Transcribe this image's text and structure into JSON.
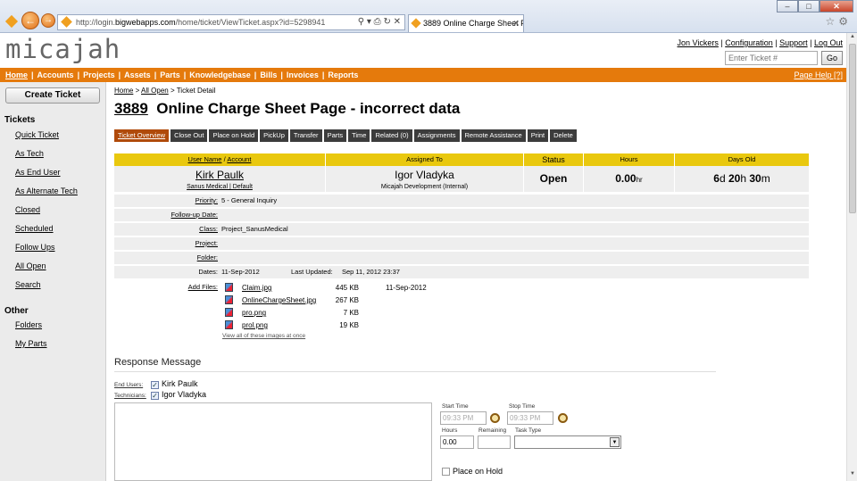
{
  "browser": {
    "url_prefix": "http://login.",
    "url_domain": "bigwebapps.com",
    "url_rest": "/home/ticket/ViewTicket.aspx?id=5298941",
    "tab_title": "3889 Online Charge Sheet P..."
  },
  "header": {
    "logo": "micajah",
    "user_links": [
      "Jon Vickers",
      "Configuration",
      "Support",
      "Log Out"
    ],
    "ticket_search_placeholder": "Enter Ticket #",
    "go_label": "Go"
  },
  "topnav": {
    "items": [
      "Home",
      "Accounts",
      "Projects",
      "Assets",
      "Parts",
      "Knowledgebase",
      "Bills",
      "Invoices",
      "Reports"
    ],
    "help": "Page Help [?]"
  },
  "sidebar": {
    "create_ticket": "Create Ticket",
    "tickets_heading": "Tickets",
    "ticket_links": [
      "Quick Ticket",
      "As Tech",
      "As End User",
      "As Alternate Tech",
      "Closed",
      "Scheduled",
      "Follow Ups",
      "All Open",
      "Search"
    ],
    "other_heading": "Other",
    "other_links": [
      "Folders",
      "My Parts"
    ]
  },
  "breadcrumb": {
    "home": "Home",
    "all_open": "All Open",
    "current": "Ticket Detail"
  },
  "ticket": {
    "number": "3889",
    "title": "Online Charge Sheet Page - incorrect data"
  },
  "tabs": [
    "Ticket Overview",
    "Close Out",
    "Place on Hold",
    "PickUp",
    "Transfer",
    "Parts",
    "Time",
    "Related (0)",
    "Assignments",
    "Remote Assistance",
    "Print",
    "Delete"
  ],
  "summary": {
    "headers": {
      "user": "User Name",
      "account": "Account",
      "assigned": "Assigned To",
      "status": "Status",
      "hours": "Hours",
      "days": "Days Old"
    },
    "user_name": "Kirk Paulk",
    "user_sub": "Sanus Medical | Default",
    "assigned_name": "Igor Vladyka",
    "assigned_sub": "Micajah Development (Internal)",
    "status": "Open",
    "hours_value": "0.00",
    "hours_unit": "hr",
    "days": "6",
    "days_unit": "d",
    "hrs": "20",
    "hrs_unit": "h",
    "mins": "30",
    "mins_unit": "m"
  },
  "details": {
    "priority_label": "Priority:",
    "priority": "5 - General Inquiry",
    "followup_label": "Follow-up Date:",
    "class_label": "Class:",
    "class": "Project_SanusMedical",
    "project_label": "Project:",
    "folder_label": "Folder:",
    "dates_label": "Dates:",
    "dates": "11-Sep-2012",
    "updated_label": "Last Updated:",
    "updated": "Sep 11, 2012 23:37",
    "addfiles_label": "Add Files:"
  },
  "files": [
    {
      "name": "Claim.jpg",
      "size": "445 KB",
      "date": "11-Sep-2012"
    },
    {
      "name": "OnlineChargeSheet.jpg",
      "size": "267 KB",
      "date": ""
    },
    {
      "name": "pro.png",
      "size": "7 KB",
      "date": ""
    },
    {
      "name": "prol.png",
      "size": "19 KB",
      "date": ""
    }
  ],
  "view_all": "View all of these images at once",
  "response": {
    "heading": "Response Message",
    "end_users_label": "End Users:",
    "end_user": "Kirk Paulk",
    "technicians_label": "Technicians:",
    "technician": "Igor Vladyka",
    "start_time_label": "Start Time",
    "start_time": "09:33 PM",
    "stop_time_label": "Stop Time",
    "stop_time": "09:33 PM",
    "hours_label": "Hours",
    "hours": "0.00",
    "remaining_label": "Remaining",
    "task_type_label": "Task Type",
    "place_on_hold": "Place on Hold"
  }
}
